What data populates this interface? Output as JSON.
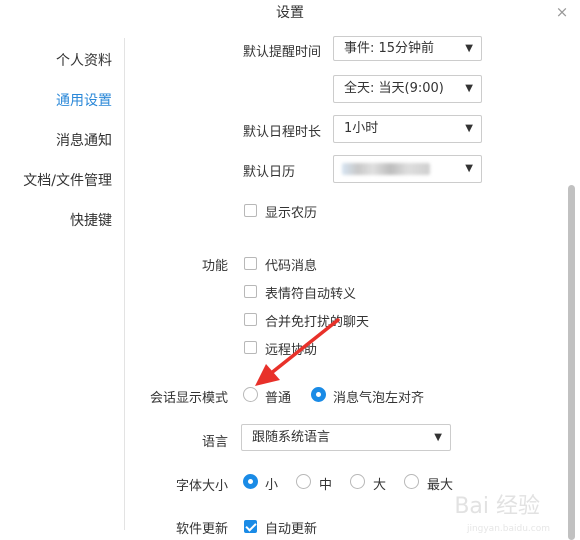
{
  "window": {
    "title": "设置",
    "close_glyph": "×"
  },
  "sidebar": {
    "items": [
      {
        "label": "个人资料",
        "active": false
      },
      {
        "label": "通用设置",
        "active": true
      },
      {
        "label": "消息通知",
        "active": false
      },
      {
        "label": "文档/文件管理",
        "active": false
      },
      {
        "label": "快捷键",
        "active": false
      }
    ]
  },
  "calendar": {
    "reminder_label": "默认提醒时间",
    "reminder_event_value": "事件: 15分钟前",
    "reminder_allday_value": "全天: 当天(9:00)",
    "duration_label": "默认日程时长",
    "duration_value": "1小时",
    "default_calendar_label": "默认日历",
    "lunar_label": "显示农历",
    "lunar_checked": false
  },
  "features": {
    "label": "功能",
    "options": [
      {
        "label": "代码消息",
        "checked": false
      },
      {
        "label": "表情符自动转义",
        "checked": false
      },
      {
        "label": "合并免打扰的聊天",
        "checked": false
      },
      {
        "label": "远程协助",
        "checked": false
      }
    ]
  },
  "chat_mode": {
    "label": "会话显示模式",
    "options": [
      {
        "label": "普通",
        "checked": false
      },
      {
        "label": "消息气泡左对齐",
        "checked": true
      }
    ]
  },
  "language": {
    "label": "语言",
    "value": "跟随系统语言"
  },
  "font_size": {
    "label": "字体大小",
    "options": [
      {
        "label": "小",
        "checked": true
      },
      {
        "label": "中",
        "checked": false
      },
      {
        "label": "大",
        "checked": false
      },
      {
        "label": "最大",
        "checked": false
      }
    ]
  },
  "update": {
    "label": "软件更新",
    "option_label": "自动更新",
    "checked": true
  },
  "icons": {
    "caret": "▼",
    "annotation": "red-arrow-icon"
  },
  "colors": {
    "accent": "#1a8be6",
    "active_nav": "#2b88d8",
    "arrow": "#e8312a"
  },
  "watermark": {
    "text": "Bai 经验",
    "sub": "jingyan.baidu.com"
  }
}
